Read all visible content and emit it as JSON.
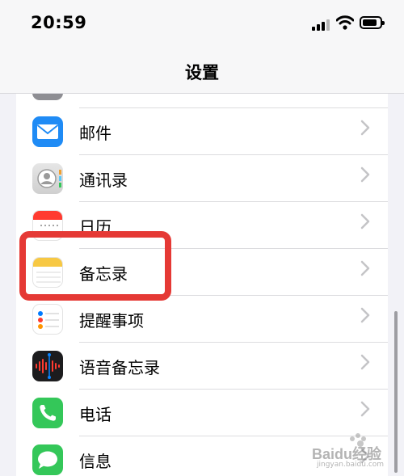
{
  "status_bar": {
    "time": "20:59"
  },
  "nav": {
    "title": "设置"
  },
  "settings": [
    {
      "label": "邮件",
      "icon": "mail-icon",
      "color": "#1f8bf5"
    },
    {
      "label": "通讯录",
      "icon": "contacts-icon",
      "color": "#dcdcdc"
    },
    {
      "label": "日历",
      "icon": "calendar-icon",
      "color": "#ffffff"
    },
    {
      "label": "备忘录",
      "icon": "notes-icon",
      "color": "#f7c843"
    },
    {
      "label": "提醒事项",
      "icon": "reminders-icon",
      "color": "#ffffff"
    },
    {
      "label": "语音备忘录",
      "icon": "voice-memos-icon",
      "color": "#1c1c1e"
    },
    {
      "label": "电话",
      "icon": "phone-icon",
      "color": "#34c759"
    },
    {
      "label": "信息",
      "icon": "messages-icon",
      "color": "#34c759"
    }
  ],
  "highlight_color": "#e53935",
  "watermark": {
    "brand": "Baidu经验",
    "url": "jingyan.baidu.com"
  }
}
